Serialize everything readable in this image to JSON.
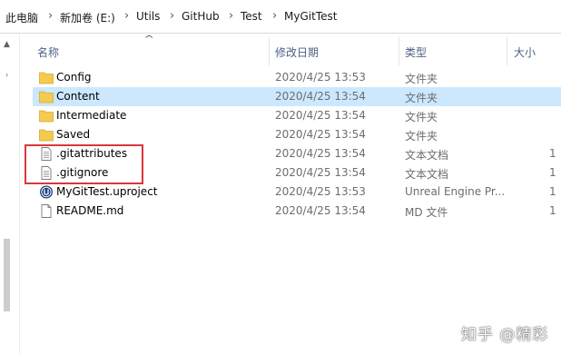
{
  "breadcrumb": {
    "items": [
      "此电脑",
      "新加卷 (E:)",
      "Utils",
      "GitHub",
      "Test",
      "MyGitTest"
    ]
  },
  "columns": {
    "name": "名称",
    "date": "修改日期",
    "type": "类型",
    "size": "大小"
  },
  "files": [
    {
      "name": "Config",
      "date": "2020/4/25 13:53",
      "type": "文件夹",
      "size": "",
      "icon": "folder-icon"
    },
    {
      "name": "Content",
      "date": "2020/4/25 13:54",
      "type": "文件夹",
      "size": "",
      "icon": "folder-icon"
    },
    {
      "name": "Intermediate",
      "date": "2020/4/25 13:54",
      "type": "文件夹",
      "size": "",
      "icon": "folder-icon"
    },
    {
      "name": "Saved",
      "date": "2020/4/25 13:54",
      "type": "文件夹",
      "size": "",
      "icon": "folder-icon"
    },
    {
      "name": ".gitattributes",
      "date": "2020/4/25 13:54",
      "type": "文本文档",
      "size": "1",
      "icon": "text-file-icon"
    },
    {
      "name": ".gitignore",
      "date": "2020/4/25 13:54",
      "type": "文本文档",
      "size": "1",
      "icon": "text-file-icon"
    },
    {
      "name": "MyGitTest.uproject",
      "date": "2020/4/25 13:53",
      "type": "Unreal Engine Pr...",
      "size": "1",
      "icon": "unreal-engine-icon"
    },
    {
      "name": "README.md",
      "date": "2020/4/25 13:54",
      "type": "MD 文件",
      "size": "1",
      "icon": "document-icon"
    }
  ],
  "watermark": "知乎 @精彩",
  "colors": {
    "selected_row": "#cce8ff",
    "highlight_box": "#d9373e",
    "folder": "#f6c94f",
    "header_text": "#4d6185"
  }
}
